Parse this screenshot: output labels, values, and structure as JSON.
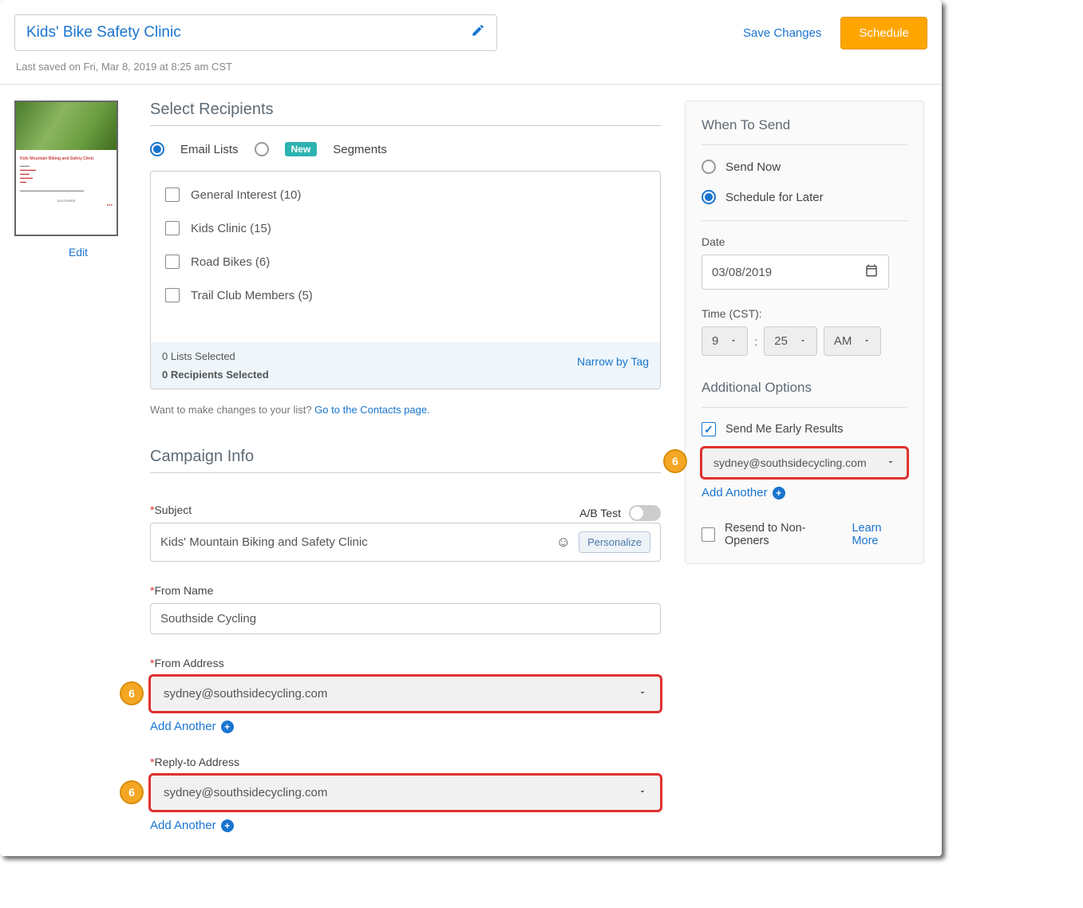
{
  "header": {
    "title": "Kids' Bike Safety Clinic",
    "save_changes": "Save Changes",
    "schedule": "Schedule",
    "last_saved": "Last saved on Fri, Mar 8, 2019 at 8:25 am CST"
  },
  "thumb": {
    "edit": "Edit"
  },
  "recipients": {
    "heading": "Select Recipients",
    "tab_email": "Email Lists",
    "tab_segments": "Segments",
    "new_badge": "New",
    "lists": [
      {
        "label": "General Interest (10)"
      },
      {
        "label": "Kids Clinic (15)"
      },
      {
        "label": "Road Bikes (6)"
      },
      {
        "label": "Trail Club Members (5)"
      }
    ],
    "lists_selected": "0 Lists Selected",
    "recipients_selected": "0 Recipients Selected",
    "narrow": "Narrow by Tag",
    "hint_pre": "Want to make changes to your list? ",
    "hint_link": "Go to the Contacts page."
  },
  "campaign": {
    "heading": "Campaign Info",
    "subject_label": "Subject",
    "ab_label": "A/B Test",
    "subject_value": "Kids' Mountain Biking and Safety Clinic",
    "personalize": "Personalize",
    "from_name_label": "From Name",
    "from_name_value": "Southside Cycling",
    "from_addr_label": "From Address",
    "from_addr_value": "sydney@southsidecycling.com",
    "reply_label": "Reply-to Address",
    "reply_value": "sydney@southsidecycling.com",
    "add_another": "Add Another"
  },
  "schedule": {
    "heading": "When To Send",
    "send_now": "Send Now",
    "schedule_later": "Schedule for Later",
    "date_label": "Date",
    "date_value": "03/08/2019",
    "time_label": "Time (CST):",
    "hour": "9",
    "minute": "25",
    "ampm": "AM",
    "additional_heading": "Additional Options",
    "early_results": "Send Me Early Results",
    "early_email": "sydney@southsidecycling.com",
    "add_another": "Add Another",
    "resend": "Resend to Non-Openers",
    "learn_more": "Learn More"
  },
  "marker": "6"
}
